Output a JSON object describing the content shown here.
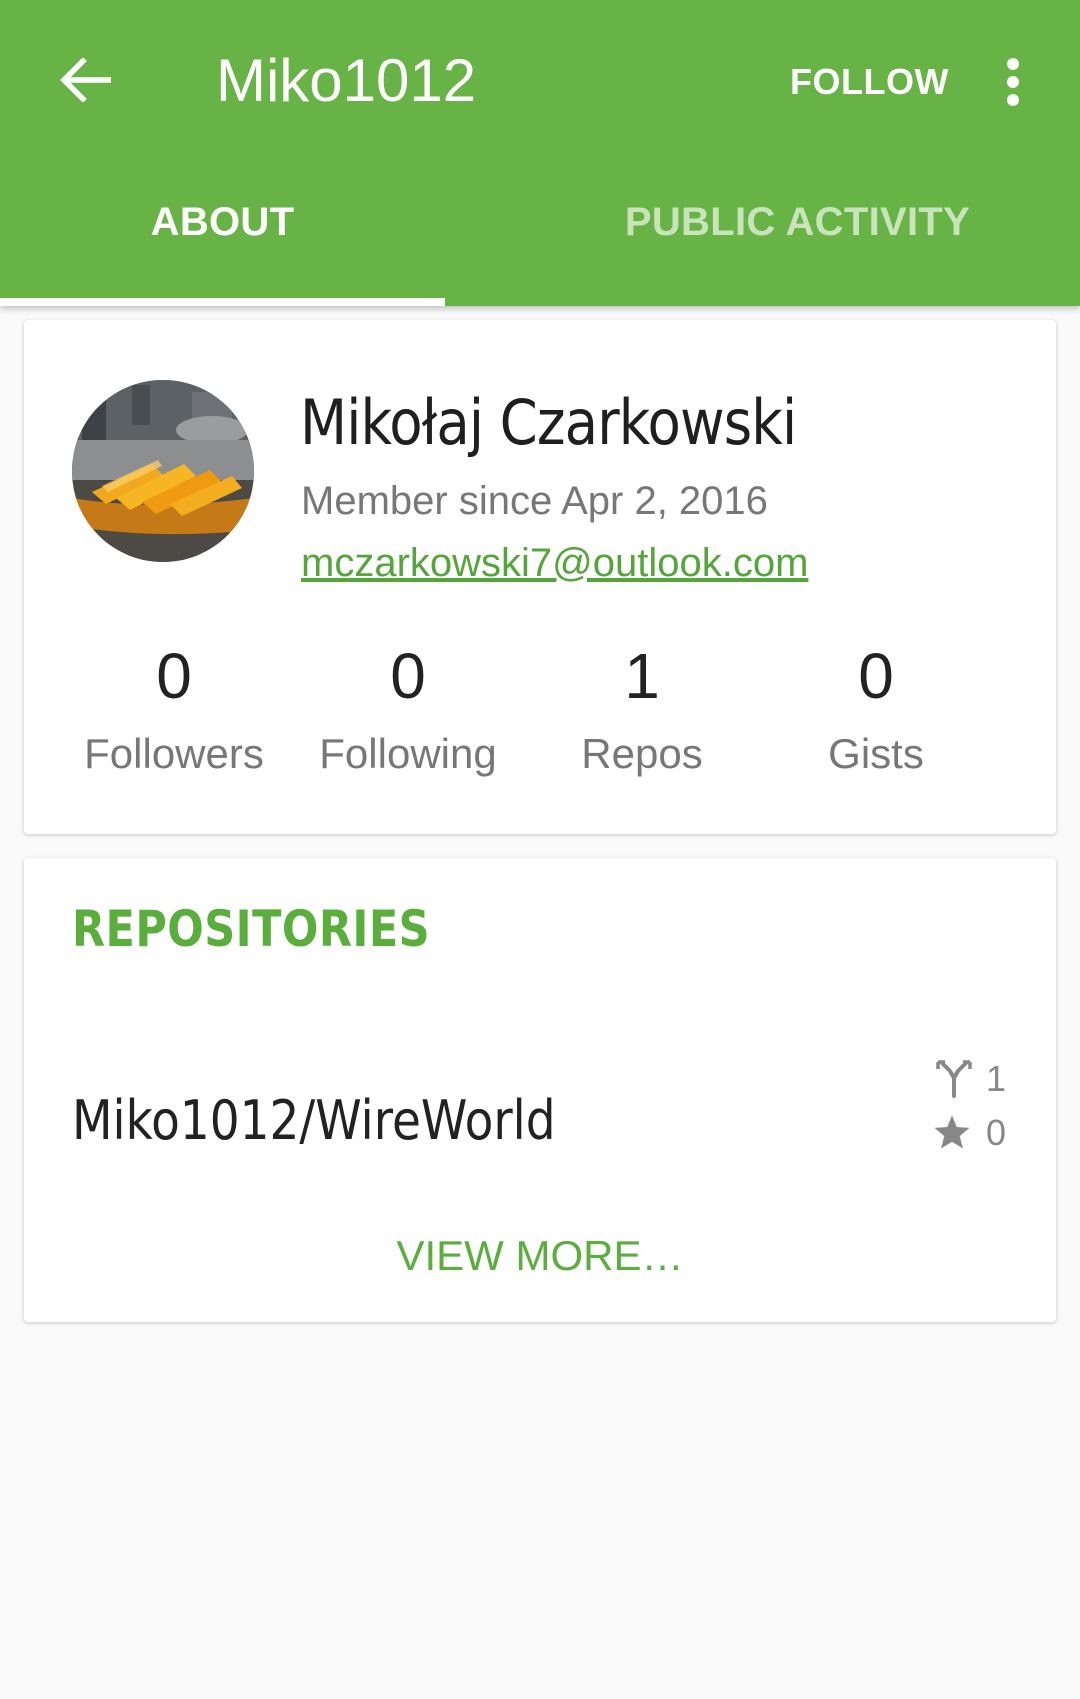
{
  "appbar": {
    "title": "Miko1012",
    "follow_label": "FOLLOW",
    "back_icon": "arrow-back-icon",
    "overflow_icon": "more-vert-icon",
    "color": "#67b346"
  },
  "tabs": [
    {
      "label": "ABOUT",
      "selected": true
    },
    {
      "label": "PUBLIC ACTIVITY",
      "selected": false
    }
  ],
  "profile": {
    "name": "Mikołaj Czarkowski",
    "member_since": "Member since Apr 2, 2016",
    "email": "mczarkowski7@outlook.com",
    "stats": [
      {
        "value": "0",
        "label": "Followers"
      },
      {
        "value": "0",
        "label": "Following"
      },
      {
        "value": "1",
        "label": "Repos"
      },
      {
        "value": "0",
        "label": "Gists"
      }
    ]
  },
  "repositories": {
    "header": "REPOSITORIES",
    "items": [
      {
        "name": "Miko1012/WireWorld",
        "forks": "1",
        "stars": "0"
      }
    ],
    "view_more_label": "VIEW MORE…"
  },
  "colors": {
    "accent": "#5aae3b",
    "background": "#fafafa"
  }
}
